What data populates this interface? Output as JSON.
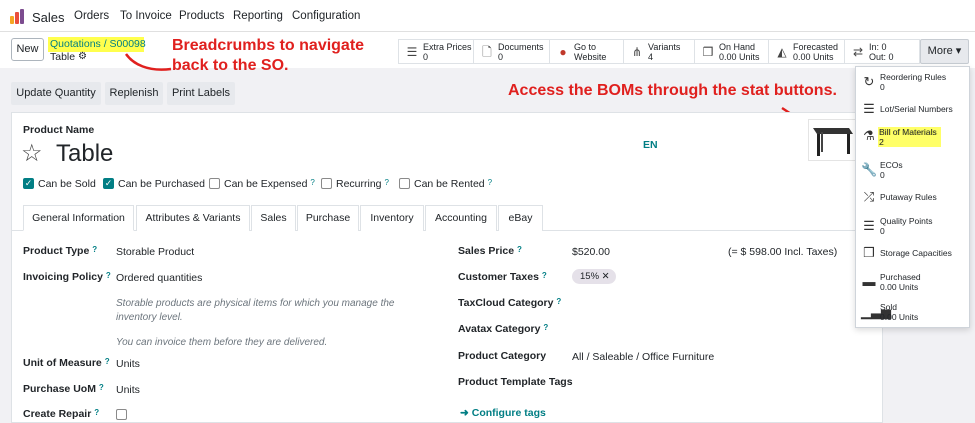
{
  "app": {
    "name": "Sales"
  },
  "menu": [
    "Orders",
    "To Invoice",
    "Products",
    "Reporting",
    "Configuration"
  ],
  "control": {
    "new_label": "New",
    "breadcrumb": "Quotations  /  S00098",
    "current": "Table"
  },
  "stat_buttons": [
    {
      "icon": "list-icon",
      "title": "Extra Prices",
      "value": "0"
    },
    {
      "icon": "document-icon",
      "title": "Documents",
      "value": "0"
    },
    {
      "icon": "globe-icon",
      "title": "Go to",
      "value": "Website"
    },
    {
      "icon": "sitemap-icon",
      "title": "Variants",
      "value": "4"
    },
    {
      "icon": "cubes-icon",
      "title": "On Hand",
      "value": "0.00 Units"
    },
    {
      "icon": "area-chart-icon",
      "title": "Forecasted",
      "value": "0.00 Units"
    },
    {
      "icon": "exchange-icon",
      "title": "In: 0",
      "value": "Out: 0"
    }
  ],
  "more_label": "More ▾",
  "actions": [
    "Update Quantity",
    "Replenish",
    "Print Labels"
  ],
  "annotations": {
    "breadcrumbs": "Breadcrumbs to navigate\nback to the SO.",
    "boms": "Access the BOMs through the stat buttons."
  },
  "product": {
    "name_label": "Product Name",
    "name": "Table",
    "lang": "EN"
  },
  "checkboxes": [
    {
      "label": "Can be Sold",
      "checked": true
    },
    {
      "label": "Can be Purchased",
      "checked": true
    },
    {
      "label": "Can be Expensed",
      "checked": false,
      "help": true
    },
    {
      "label": "Recurring",
      "checked": false,
      "help": true
    },
    {
      "label": "Can be Rented",
      "checked": false,
      "help": true
    }
  ],
  "tabs": [
    "General Information",
    "Attributes & Variants",
    "Sales",
    "Purchase",
    "Inventory",
    "Accounting",
    "eBay"
  ],
  "fields_left": {
    "product_type_label": "Product Type",
    "product_type": "Storable Product",
    "invoicing_label": "Invoicing Policy",
    "invoicing": "Ordered quantities",
    "help1": "Storable products are physical items for which you manage the inventory level.",
    "help2": "You can invoice them before they are delivered.",
    "uom_label": "Unit of Measure",
    "uom": "Units",
    "puom_label": "Purchase UoM",
    "puom": "Units",
    "repair_label": "Create Repair"
  },
  "fields_right": {
    "sales_price_label": "Sales Price",
    "sales_price": "$520.00",
    "incl_taxes": "(= $ 598.00 Incl. Taxes)",
    "customer_taxes_label": "Customer Taxes",
    "tax_tag": "15%",
    "taxcloud_label": "TaxCloud Category",
    "avatax_label": "Avatax Category",
    "category_label": "Product Category",
    "category": "All / Saleable / Office Furniture",
    "template_tags_label": "Product Template Tags",
    "configure_tags": "Configure tags"
  },
  "dropdown": [
    {
      "icon": "reorder-icon",
      "title": "Reordering Rules",
      "value": "0"
    },
    {
      "icon": "list-icon",
      "title": "Lot/Serial Numbers",
      "value": ""
    },
    {
      "icon": "flask-icon",
      "title": "Bill of Materials",
      "value": "2"
    },
    {
      "icon": "wrench-icon",
      "title": "ECOs",
      "value": "0"
    },
    {
      "icon": "random-icon",
      "title": "Putaway Rules",
      "value": ""
    },
    {
      "icon": "list-icon",
      "title": "Quality Points",
      "value": "0"
    },
    {
      "icon": "cubes-icon",
      "title": "Storage Capacities",
      "value": ""
    },
    {
      "icon": "credit-card-icon",
      "title": "Purchased",
      "value": "0.00 Units"
    },
    {
      "icon": "signal-icon",
      "title": "Sold",
      "value": "0.00 Units"
    }
  ],
  "colors": {
    "accent": "#017e84",
    "annotation": "#e0201e",
    "highlight": "#ffff4d"
  }
}
